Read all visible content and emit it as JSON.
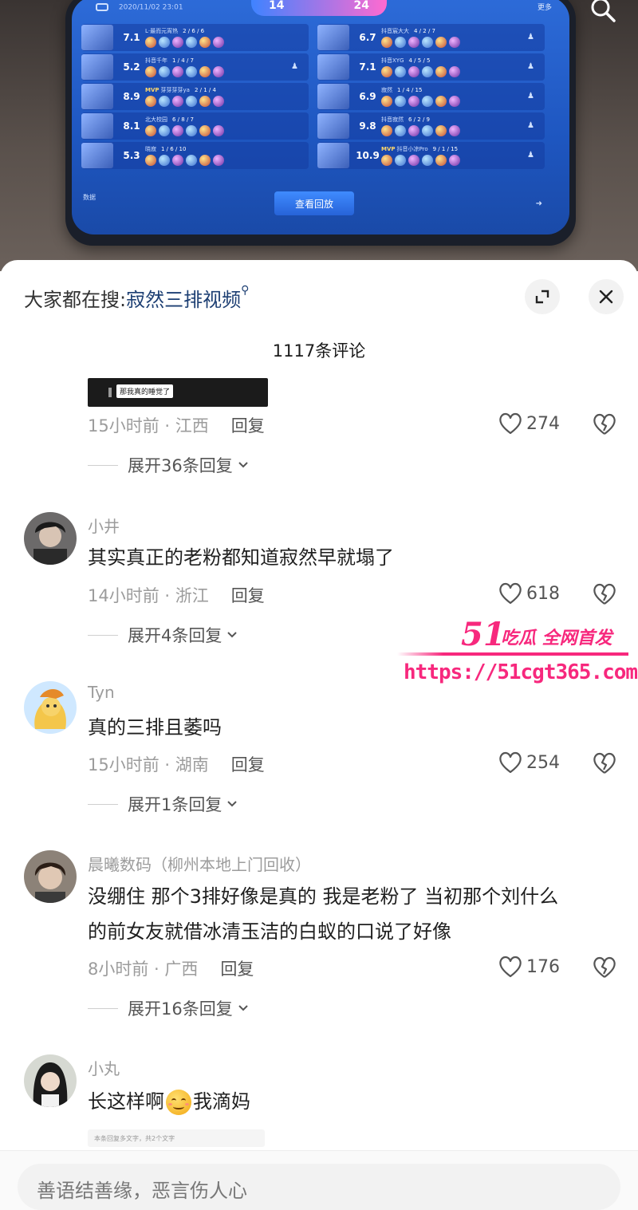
{
  "photo": {
    "status": "2020/11/02 23:01",
    "score_left": "14",
    "score_right": "24",
    "more_label": "更多",
    "replay_label": "查看回放",
    "data_label": "数据",
    "left_team": [
      {
        "rating": "7.1",
        "kda": "2 / 6 / 6",
        "name": "L·最而元宵热"
      },
      {
        "rating": "5.2",
        "kda": "1 / 4 / 7",
        "name": "抖音千年"
      },
      {
        "rating": "8.9",
        "kda": "2 / 1 / 4",
        "name": "芽芽芽芽ya",
        "tag": "MVP"
      },
      {
        "rating": "8.1",
        "kda": "6 / 8 / 7",
        "name": "北大校园"
      },
      {
        "rating": "5.3",
        "kda": "1 / 6 / 10",
        "name": "晓寂"
      }
    ],
    "right_team": [
      {
        "rating": "6.7",
        "kda": "4 / 2 / 7",
        "name": "抖音宸大大"
      },
      {
        "rating": "7.1",
        "kda": "4 / 5 / 5",
        "name": "抖音XYG"
      },
      {
        "rating": "6.9",
        "kda": "1 / 4 / 15",
        "name": "寂然"
      },
      {
        "rating": "9.8",
        "kda": "6 / 2 / 9",
        "name": "抖音寂然"
      },
      {
        "rating": "10.9",
        "kda": "9 / 1 / 15",
        "name": "抖音小凉Pro",
        "tag": "MVP"
      }
    ]
  },
  "header": {
    "search_prefix": "大家都在搜:",
    "search_keyword": "寂然三排视频",
    "comment_count": "1117条评论"
  },
  "first_comment": {
    "image_caption": "那我真的睡觉了",
    "meta_time": "15小时前 · 江西",
    "reply": "回复",
    "likes": "274",
    "expand": "展开36条回复"
  },
  "comments": [
    {
      "name": "小井",
      "text": "其实真正的老粉都知道寂然早就塌了",
      "meta": "14小时前 · 浙江",
      "reply": "回复",
      "likes": "618",
      "expand": "展开4条回复"
    },
    {
      "name": "Tyn",
      "text": "真的三排且萎吗",
      "meta": "15小时前 · 湖南",
      "reply": "回复",
      "likes": "254",
      "expand": "展开1条回复"
    },
    {
      "name": "晨曦数码（柳州本地上门回收）",
      "text_line1": "没绷住 那个3排好像是真的 我是老粉了 当初那个刘什么",
      "text_line2": "的前女友就借冰清玉洁的白蚁的口说了好像",
      "meta": "8小时前 · 广西",
      "reply": "回复",
      "likes": "176",
      "expand": "展开16条回复"
    },
    {
      "name": "小丸",
      "text_before": "长这样啊",
      "text_after": "我滴妈",
      "partial": "本条回复多文字，共2个文字"
    }
  ],
  "input": {
    "placeholder": "善语结善缘，恶言伤人心"
  },
  "watermark": {
    "big": "51",
    "tag": "吃瓜 全网首发",
    "url": "https://51cgt365.com"
  }
}
